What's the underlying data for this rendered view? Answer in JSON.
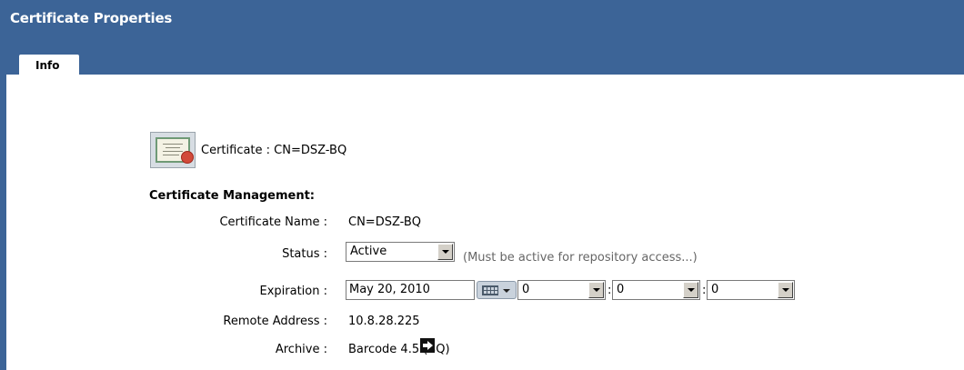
{
  "header": {
    "title": "Certificate Properties"
  },
  "tabs": [
    {
      "label": "Info"
    }
  ],
  "certificate": {
    "label": "Certificate : CN=DSZ-BQ"
  },
  "management": {
    "heading": "Certificate Management:",
    "name_label": "Certificate Name :",
    "name_value": "CN=DSZ-BQ",
    "status_label": "Status :",
    "status_value": "Active",
    "status_note": "(Must be active for repository access...)",
    "expiration_label": "Expiration :",
    "expiration_date": "May 20, 2010",
    "expiration_hour": "0",
    "expiration_minute": "0",
    "expiration_second": "0",
    "colon": ":",
    "remote_label": "Remote Address :",
    "remote_value": "10.8.28.225",
    "archive_label": "Archive :",
    "archive_value": "Barcode 4.5 (BQ)"
  },
  "icons": {
    "certificate": "certificate-icon",
    "calendar": "calendar-icon",
    "go": "arrow-right-icon"
  }
}
